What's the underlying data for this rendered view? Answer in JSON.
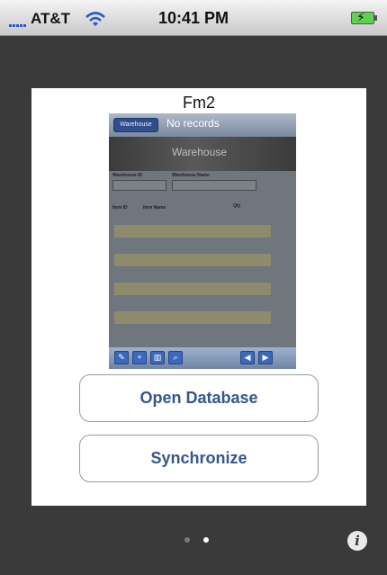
{
  "status_bar": {
    "carrier": "AT&T",
    "time": "10:41 PM",
    "icons": [
      "signal-icon",
      "wifi-icon",
      "battery-charging-icon"
    ]
  },
  "card": {
    "title": "Fm2",
    "preview": {
      "tab_label": "Warehouse",
      "record_status": "No records",
      "banner_title": "Warehouse",
      "fields": {
        "warehouse_id": "Warehouse ID",
        "warehouse_name": "Warehouse Name",
        "item_id": "Item ID",
        "item_name": "Item Name",
        "qty": "Qty"
      },
      "toolbar_icons": [
        "edit-icon",
        "add-icon",
        "delete-icon",
        "search-icon",
        "prev-icon",
        "next-icon"
      ]
    },
    "buttons": {
      "open_database": "Open Database",
      "synchronize": "Synchronize"
    }
  },
  "page_indicator": {
    "total": 2,
    "current": 2
  },
  "info_button": {
    "icon": "info-icon",
    "glyph": "i"
  },
  "colors": {
    "background": "#3a3a3a",
    "button_text": "#35568f",
    "dot_active": "#ffffff",
    "dot_inactive": "#7a7a7a"
  }
}
